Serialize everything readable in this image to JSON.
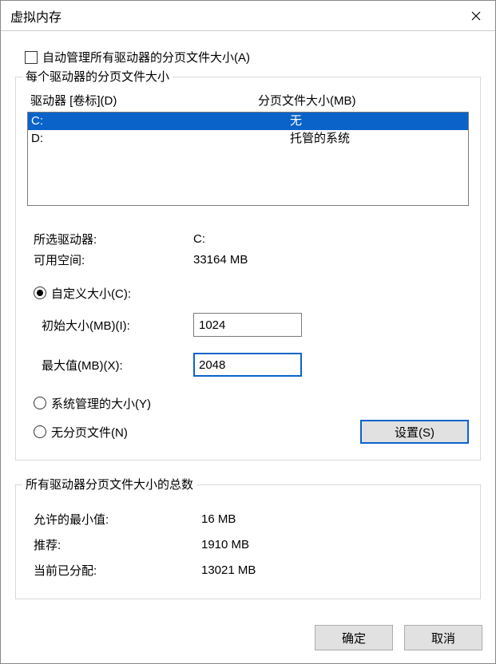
{
  "window": {
    "title": "虚拟内存"
  },
  "autoManage": {
    "label": "自动管理所有驱动器的分页文件大小(A)",
    "checked": false
  },
  "driveGroup": {
    "title": "每个驱动器的分页文件大小",
    "headerDrive": "驱动器 [卷标](D)",
    "headerPage": "分页文件大小(MB)",
    "drives": [
      {
        "letter": "C:",
        "status": "无",
        "selected": true
      },
      {
        "letter": "D:",
        "status": "托管的系统",
        "selected": false
      }
    ],
    "selectedDrive": {
      "label": "所选驱动器:",
      "value": "C:"
    },
    "freeSpace": {
      "label": "可用空间:",
      "value": "33164 MB"
    },
    "customSize": {
      "label": "自定义大小(C):",
      "checked": true
    },
    "initialSize": {
      "label": "初始大小(MB)(I):",
      "value": "1024"
    },
    "maxSize": {
      "label": "最大值(MB)(X):",
      "value": "2048"
    },
    "systemManaged": {
      "label": "系统管理的大小(Y)",
      "checked": false
    },
    "noPageFile": {
      "label": "无分页文件(N)",
      "checked": false
    },
    "setButton": "设置(S)"
  },
  "totalsGroup": {
    "title": "所有驱动器分页文件大小的总数",
    "minAllowed": {
      "label": "允许的最小值:",
      "value": "16 MB"
    },
    "recommended": {
      "label": "推荐:",
      "value": "1910 MB"
    },
    "currentAlloc": {
      "label": "当前已分配:",
      "value": "13021 MB"
    }
  },
  "buttons": {
    "ok": "确定",
    "cancel": "取消"
  }
}
